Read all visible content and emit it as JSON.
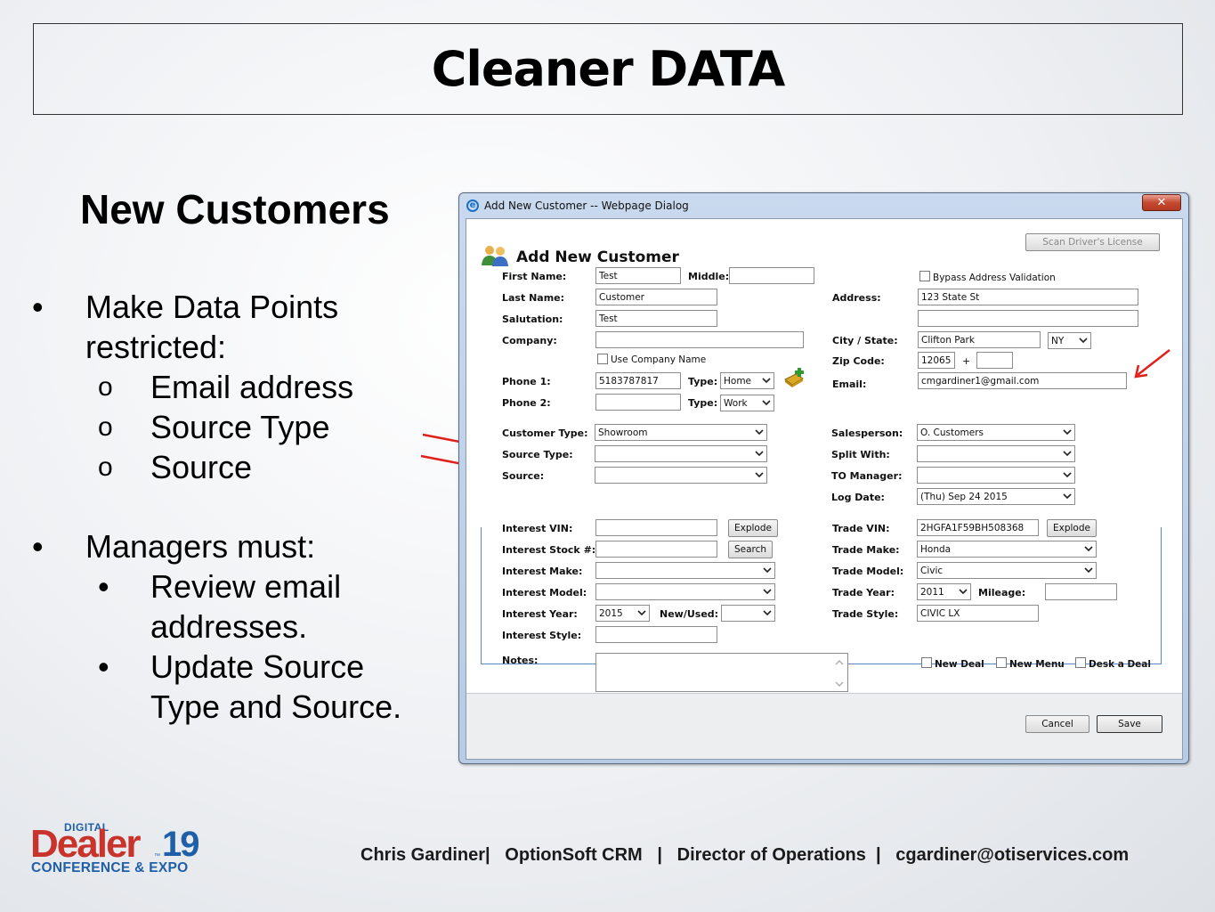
{
  "slide": {
    "title": "Cleaner DATA",
    "subtitle": "New Customers",
    "bullets": [
      {
        "mark": "•",
        "text": "Make Data Points",
        "level": 1
      },
      {
        "mark": "",
        "text": "restricted:",
        "level": 1
      },
      {
        "mark": "o",
        "text": "Email address",
        "level": 2
      },
      {
        "mark": "o",
        "text": "Source Type",
        "level": 2
      },
      {
        "mark": "o",
        "text": "Source",
        "level": 2
      },
      {
        "mark": "•",
        "text": "Managers must:",
        "level": 1
      },
      {
        "mark": "•",
        "text": "Review email",
        "level": 2
      },
      {
        "mark": "",
        "text": "addresses.",
        "level": 2
      },
      {
        "mark": "•",
        "text": "Update Source",
        "level": 2
      },
      {
        "mark": "",
        "text": "Type and Source.",
        "level": 2
      }
    ],
    "footer": "Chris Gardiner|   OptionSoft CRM   |   Director of Operations  |   cgardiner@otiservices.com",
    "arrow_color": "#e0201b"
  },
  "logo": {
    "top": "DIGITAL",
    "main": "Dealer",
    "year": "19",
    "tm": "™",
    "bottom": "CONFERENCE & EXPO",
    "red": "#c8332b",
    "blue": "#1f5fa8"
  },
  "dialog": {
    "window_title": "Add New Customer -- Webpage Dialog",
    "close": "✕",
    "heading": "Add New Customer",
    "scan_button": "Scan Driver's License",
    "labels": {
      "first_name": "First Name:",
      "middle": "Middle:",
      "last_name": "Last Name:",
      "salutation": "Salutation:",
      "company": "Company:",
      "phone1": "Phone 1:",
      "phone2": "Phone 2:",
      "type": "Type:",
      "customer_type": "Customer Type:",
      "source_type": "Source Type:",
      "source": "Source:",
      "address": "Address:",
      "city_state": "City / State:",
      "zip": "Zip Code:",
      "email": "Email:",
      "salesperson": "Salesperson:",
      "split_with": "Split With:",
      "to_manager": "TO Manager:",
      "log_date": "Log Date:",
      "interest_vin": "Interest VIN:",
      "interest_stock": "Interest Stock #:",
      "interest_make": "Interest Make:",
      "interest_model": "Interest Model:",
      "interest_year": "Interest Year:",
      "new_used": "New/Used:",
      "interest_style": "Interest Style:",
      "trade_vin": "Trade VIN:",
      "trade_make": "Trade Make:",
      "trade_model": "Trade Model:",
      "trade_year": "Trade Year:",
      "mileage": "Mileage:",
      "trade_style": "Trade Style:",
      "notes": "Notes:",
      "plus": "+"
    },
    "values": {
      "first_name": "Test",
      "middle": "",
      "last_name": "Customer",
      "salutation": "Test",
      "company": "",
      "phone1": "5183787817",
      "phone1_type": "Home",
      "phone2": "",
      "phone2_type": "Work",
      "customer_type": "Showroom",
      "source_type": "",
      "source": "",
      "address1": "123 State St",
      "address2": "",
      "city": "Clifton Park",
      "state": "NY",
      "zip": "12065",
      "zip4": "",
      "email": "cmgardiner1@gmail.com",
      "salesperson": "O. Customers",
      "split_with": "",
      "to_manager": "",
      "log_date": "(Thu) Sep 24 2015",
      "interest_vin": "",
      "interest_stock": "",
      "interest_make": "",
      "interest_model": "",
      "interest_year": "2015",
      "new_used": "",
      "interest_style": "",
      "trade_vin": "2HGFA1F59BH508368",
      "trade_make": "Honda",
      "trade_model": "Civic",
      "trade_year": "2011",
      "mileage": "",
      "trade_style": "CIVIC LX",
      "notes": ""
    },
    "checkboxes": {
      "use_company_name": "Use Company Name",
      "bypass_address": "Bypass Address Validation",
      "new_deal": "New Deal",
      "new_menu": "New Menu",
      "desk_a_deal": "Desk a Deal"
    },
    "buttons": {
      "explode": "Explode",
      "search": "Search",
      "cancel": "Cancel",
      "save": "Save"
    }
  }
}
